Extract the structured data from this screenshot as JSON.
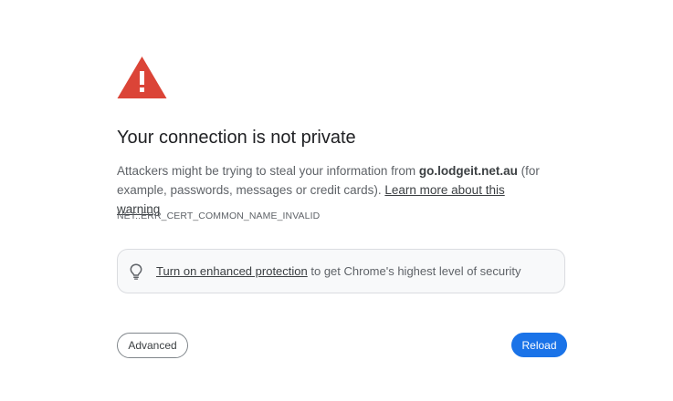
{
  "interstitial": {
    "title": "Your connection is not private",
    "message_prefix": "Attackers might be trying to steal your information from ",
    "domain": "go.lodgeit.net.au",
    "message_suffix": " (for example, passwords, messages or credit cards). ",
    "learn_more_link": "Learn more about this warning",
    "error_code": "NET::ERR_CERT_COMMON_NAME_INVALID"
  },
  "enhanced_protection": {
    "link_text": "Turn on enhanced protection",
    "suffix_text": " to get Chrome's highest level of security"
  },
  "buttons": {
    "advanced_label": "Advanced",
    "reload_label": "Reload"
  },
  "icons": {
    "warning": "warning-triangle-icon",
    "bulb": "lightbulb-icon"
  },
  "colors": {
    "warning_red": "#db4437",
    "accent_blue": "#1a73e8"
  }
}
